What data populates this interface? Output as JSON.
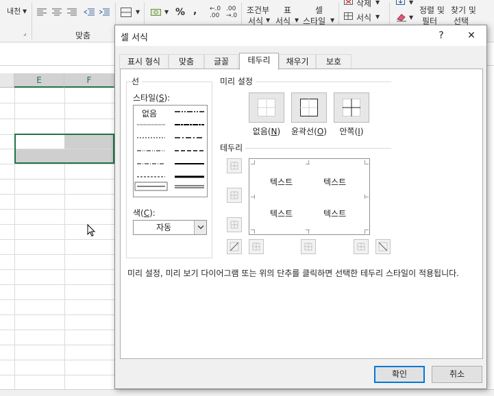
{
  "ribbon": {
    "wrap_label": "내천",
    "percent": "%",
    "comma": ",",
    "dec_inc": "←.0\n.00",
    "dec_dec": ".00\n→.0",
    "cond_format_1": "조건부",
    "cond_format_2": "서식",
    "table_format_1": "표",
    "table_format_2": "서식",
    "cell_style_1": "셀",
    "cell_style_2": "스타일",
    "delete_label": "삭제",
    "format_label": "서식",
    "sort_1": "정렬 및",
    "sort_2": "필터",
    "find_1": "찾기 및",
    "find_2": "선택",
    "group_align": "맞춤"
  },
  "sheet": {
    "columns": [
      "E",
      "F"
    ]
  },
  "dialog": {
    "title": "셀 서식",
    "help": "?",
    "close": "✕",
    "tabs": [
      "표시 형식",
      "맞춤",
      "글꼴",
      "테두리",
      "채우기",
      "보호"
    ],
    "active_tab": "테두리",
    "line_group": "선",
    "style_label": "스타일(",
    "style_key": "S",
    "style_label_end": "):",
    "style_none": "없음",
    "color_label": "색(",
    "color_key": "C",
    "color_label_end": "):",
    "color_value": "자동",
    "preset_group": "미리 설정",
    "presets": [
      {
        "label": "없음(",
        "key": "N",
        "end": ")"
      },
      {
        "label": "윤곽선(",
        "key": "O",
        "end": ")"
      },
      {
        "label": "안쪽(",
        "key": "I",
        "end": ")"
      }
    ],
    "border_group": "테두리",
    "preview_text": [
      "텍스트",
      "텍스트",
      "텍스트",
      "텍스트"
    ],
    "description": "미리 설정, 미리 보기 다이어그램 또는 위의 단추를 클릭하면 선택한 테두리 스타일이 적용됩니다.",
    "ok": "확인",
    "cancel": "취소"
  }
}
